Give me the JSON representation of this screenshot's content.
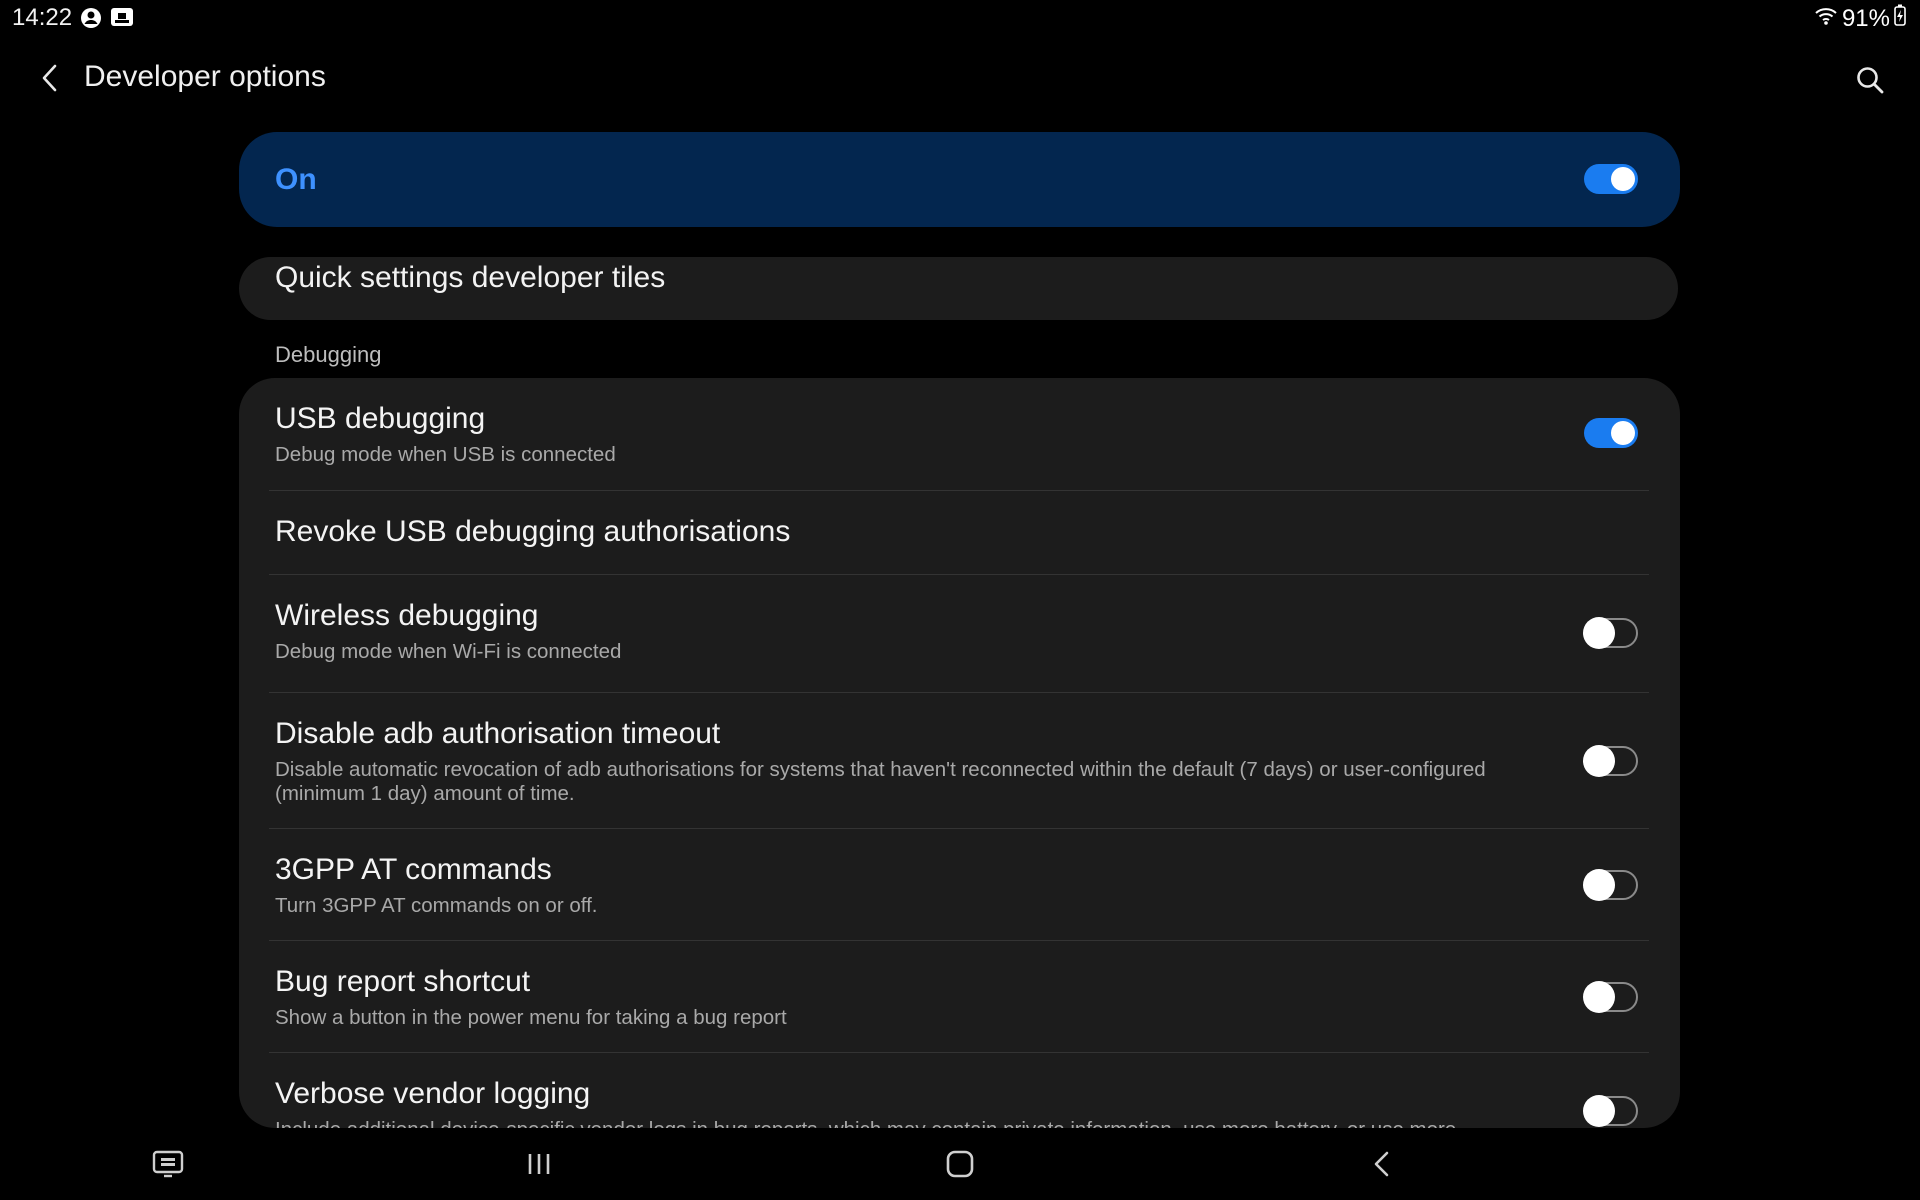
{
  "status_bar": {
    "time": "14:22",
    "battery": "91%",
    "icons": [
      "account-circle-icon",
      "screen-share-icon",
      "wifi-icon",
      "battery-charging-icon"
    ]
  },
  "header": {
    "title": "Developer options",
    "back_icon": "chevron-left-icon",
    "search_icon": "search-icon"
  },
  "master_switch": {
    "label": "On",
    "on": true
  },
  "quick_settings": {
    "label": "Quick settings developer tiles"
  },
  "sections": [
    {
      "header": "Debugging",
      "items": [
        {
          "title": "USB debugging",
          "summary": "Debug mode when USB is connected",
          "toggle": true
        },
        {
          "title": "Revoke USB debugging authorisations"
        },
        {
          "title": "Wireless debugging",
          "summary": "Debug mode when Wi-Fi is connected",
          "toggle": false
        },
        {
          "title": "Disable adb authorisation timeout",
          "summary": "Disable automatic revocation of adb authorisations for systems that haven't reconnected within the default (7 days) or user-configured (minimum 1 day) amount of time.",
          "toggle": false
        },
        {
          "title": "3GPP AT commands",
          "summary": "Turn 3GPP AT commands on or off.",
          "toggle": false
        },
        {
          "title": "Bug report shortcut",
          "summary": "Show a button in the power menu for taking a bug report",
          "toggle": false
        },
        {
          "title": "Verbose vendor logging",
          "summary": "Include additional device-specific vendor logs in bug reports, which may contain private information, use more battery, or use more",
          "toggle": false
        }
      ]
    }
  ],
  "nav_bar": {
    "icons": [
      "taskbar-icon",
      "recent-apps-icon",
      "home-icon",
      "back-icon"
    ]
  },
  "colors": {
    "accent": "#3e91ff",
    "toggle_on": "#1a7cf0",
    "master_bg": "#03264f",
    "card_bg": "#1c1c1c"
  }
}
